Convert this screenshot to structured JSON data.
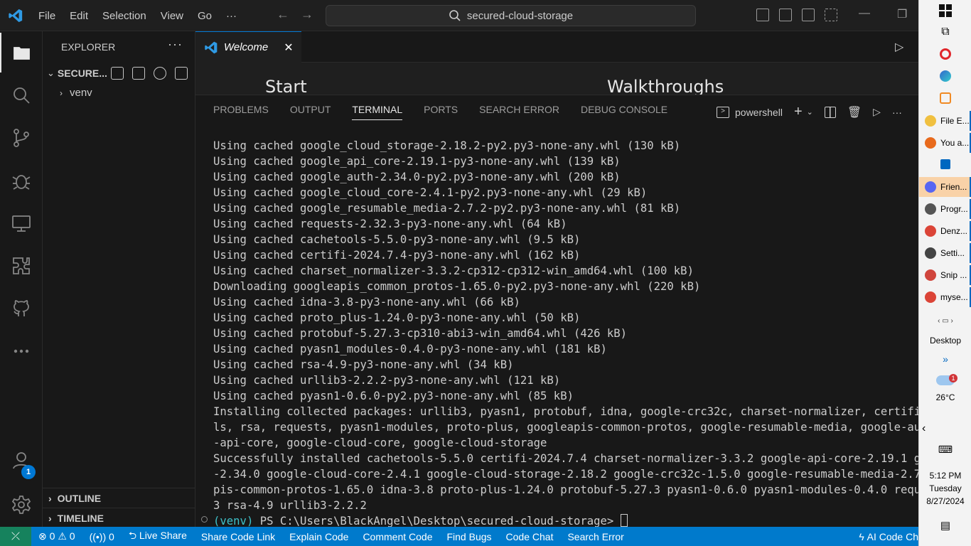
{
  "titlebar": {
    "menu": [
      "File",
      "Edit",
      "Selection",
      "View",
      "Go",
      "···"
    ],
    "search": "secured-cloud-storage"
  },
  "explorer": {
    "header": "EXPLORER",
    "more": "···",
    "folder_name": "SECURE...",
    "items": [
      "venv"
    ],
    "outline": "OUTLINE",
    "timeline": "TIMELINE"
  },
  "activity": {
    "accounts_badge": "1"
  },
  "editor": {
    "tab_title": "Welcome",
    "welcome_start": "Start",
    "welcome_walkthroughs": "Walkthroughs"
  },
  "panel": {
    "tabs": [
      "PROBLEMS",
      "OUTPUT",
      "TERMINAL",
      "PORTS",
      "SEARCH ERROR",
      "DEBUG CONSOLE"
    ],
    "active_tab": "TERMINAL",
    "shell": "powershell",
    "terminal_lines": [
      "Using cached google_cloud_storage-2.18.2-py2.py3-none-any.whl (130 kB)",
      "Using cached google_api_core-2.19.1-py3-none-any.whl (139 kB)",
      "Using cached google_auth-2.34.0-py2.py3-none-any.whl (200 kB)",
      "Using cached google_cloud_core-2.4.1-py2.py3-none-any.whl (29 kB)",
      "Using cached google_resumable_media-2.7.2-py2.py3-none-any.whl (81 kB)",
      "Using cached requests-2.32.3-py3-none-any.whl (64 kB)",
      "Using cached cachetools-5.5.0-py3-none-any.whl (9.5 kB)",
      "Using cached certifi-2024.7.4-py3-none-any.whl (162 kB)",
      "Using cached charset_normalizer-3.3.2-cp312-cp312-win_amd64.whl (100 kB)",
      "Downloading googleapis_common_protos-1.65.0-py2.py3-none-any.whl (220 kB)",
      "Using cached idna-3.8-py3-none-any.whl (66 kB)",
      "Using cached proto_plus-1.24.0-py3-none-any.whl (50 kB)",
      "Using cached protobuf-5.27.3-cp310-abi3-win_amd64.whl (426 kB)",
      "Using cached pyasn1_modules-0.4.0-py3-none-any.whl (181 kB)",
      "Using cached rsa-4.9-py3-none-any.whl (34 kB)",
      "Using cached urllib3-2.2.2-py3-none-any.whl (121 kB)",
      "Using cached pyasn1-0.6.0-py2.py3-none-any.whl (85 kB)",
      "Installing collected packages: urllib3, pyasn1, protobuf, idna, google-crc32c, charset-normalizer, certifi, cac",
      "ls, rsa, requests, pyasn1-modules, proto-plus, googleapis-common-protos, google-resumable-media, google-auth, g",
      "-api-core, google-cloud-core, google-cloud-storage",
      "Successfully installed cachetools-5.5.0 certifi-2024.7.4 charset-normalizer-3.3.2 google-api-core-2.19.1 google",
      "-2.34.0 google-cloud-core-2.4.1 google-cloud-storage-2.18.2 google-crc32c-1.5.0 google-resumable-media-2.7.2 goo",
      "pis-common-protos-1.65.0 idna-3.8 proto-plus-1.24.0 protobuf-5.27.3 pyasn1-0.6.0 pyasn1-modules-0.4.0 requests",
      "3 rsa-4.9 urllib3-2.2.2"
    ],
    "prompt_venv": "(venv)",
    "prompt_path": " PS C:\\Users\\BlackAngel\\Desktop\\secured-cloud-storage> "
  },
  "statusbar": {
    "errors": "0",
    "warnings": "0",
    "ports": "0",
    "items": [
      "Live Share",
      "Share Code Link",
      "Explain Code",
      "Comment Code",
      "Find Bugs",
      "Code Chat",
      "Search Error"
    ],
    "ai": "AI Code Ch"
  },
  "taskbar": {
    "apps": [
      {
        "label": "File E...",
        "color": "#f0c040"
      },
      {
        "label": "You a...",
        "color": "#e86a1c"
      },
      {
        "label": "Frien...",
        "color": "#5865f2"
      },
      {
        "label": "Progr...",
        "color": "#555555"
      },
      {
        "label": "Denz...",
        "color": "#db4437"
      },
      {
        "label": "Setti...",
        "color": "#444444"
      },
      {
        "label": "Snip ...",
        "color": "#d0453c"
      },
      {
        "label": "myse...",
        "color": "#db4437"
      }
    ],
    "desktop": "Desktop",
    "chevrons": "»",
    "weather_badge": "1",
    "temperature": "26°C",
    "time": "5:12 PM",
    "day": "Tuesday",
    "date": "8/27/2024"
  }
}
